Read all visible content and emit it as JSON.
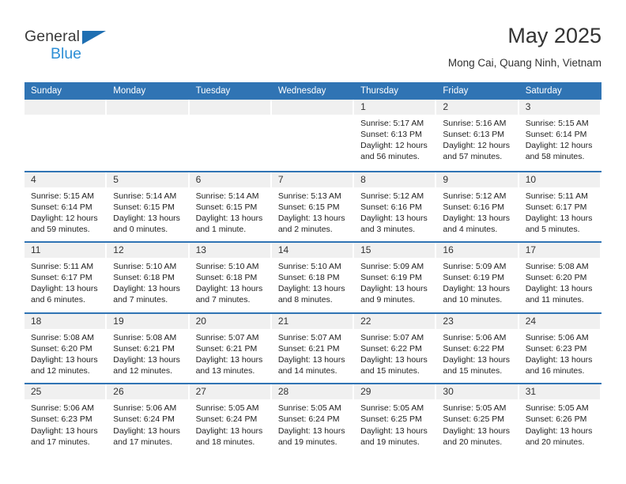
{
  "logo": {
    "top_text": "General",
    "bottom_text": "Blue",
    "triangle_color": "#1f6fb2",
    "blue_color": "#2e8fd6"
  },
  "header": {
    "title": "May 2025",
    "subtitle": "Mong Cai, Quang Ninh, Vietnam"
  },
  "colors": {
    "header_bar": "#3074b4",
    "day_band": "#f0f0f0",
    "week_divider": "#3074b4",
    "text": "#222222"
  },
  "weekdays": [
    "Sunday",
    "Monday",
    "Tuesday",
    "Wednesday",
    "Thursday",
    "Friday",
    "Saturday"
  ],
  "weeks": [
    [
      {
        "day": "",
        "sunrise": "",
        "sunset": "",
        "daylight": ""
      },
      {
        "day": "",
        "sunrise": "",
        "sunset": "",
        "daylight": ""
      },
      {
        "day": "",
        "sunrise": "",
        "sunset": "",
        "daylight": ""
      },
      {
        "day": "",
        "sunrise": "",
        "sunset": "",
        "daylight": ""
      },
      {
        "day": "1",
        "sunrise": "Sunrise: 5:17 AM",
        "sunset": "Sunset: 6:13 PM",
        "daylight": "Daylight: 12 hours and 56 minutes."
      },
      {
        "day": "2",
        "sunrise": "Sunrise: 5:16 AM",
        "sunset": "Sunset: 6:13 PM",
        "daylight": "Daylight: 12 hours and 57 minutes."
      },
      {
        "day": "3",
        "sunrise": "Sunrise: 5:15 AM",
        "sunset": "Sunset: 6:14 PM",
        "daylight": "Daylight: 12 hours and 58 minutes."
      }
    ],
    [
      {
        "day": "4",
        "sunrise": "Sunrise: 5:15 AM",
        "sunset": "Sunset: 6:14 PM",
        "daylight": "Daylight: 12 hours and 59 minutes."
      },
      {
        "day": "5",
        "sunrise": "Sunrise: 5:14 AM",
        "sunset": "Sunset: 6:15 PM",
        "daylight": "Daylight: 13 hours and 0 minutes."
      },
      {
        "day": "6",
        "sunrise": "Sunrise: 5:14 AM",
        "sunset": "Sunset: 6:15 PM",
        "daylight": "Daylight: 13 hours and 1 minute."
      },
      {
        "day": "7",
        "sunrise": "Sunrise: 5:13 AM",
        "sunset": "Sunset: 6:15 PM",
        "daylight": "Daylight: 13 hours and 2 minutes."
      },
      {
        "day": "8",
        "sunrise": "Sunrise: 5:12 AM",
        "sunset": "Sunset: 6:16 PM",
        "daylight": "Daylight: 13 hours and 3 minutes."
      },
      {
        "day": "9",
        "sunrise": "Sunrise: 5:12 AM",
        "sunset": "Sunset: 6:16 PM",
        "daylight": "Daylight: 13 hours and 4 minutes."
      },
      {
        "day": "10",
        "sunrise": "Sunrise: 5:11 AM",
        "sunset": "Sunset: 6:17 PM",
        "daylight": "Daylight: 13 hours and 5 minutes."
      }
    ],
    [
      {
        "day": "11",
        "sunrise": "Sunrise: 5:11 AM",
        "sunset": "Sunset: 6:17 PM",
        "daylight": "Daylight: 13 hours and 6 minutes."
      },
      {
        "day": "12",
        "sunrise": "Sunrise: 5:10 AM",
        "sunset": "Sunset: 6:18 PM",
        "daylight": "Daylight: 13 hours and 7 minutes."
      },
      {
        "day": "13",
        "sunrise": "Sunrise: 5:10 AM",
        "sunset": "Sunset: 6:18 PM",
        "daylight": "Daylight: 13 hours and 7 minutes."
      },
      {
        "day": "14",
        "sunrise": "Sunrise: 5:10 AM",
        "sunset": "Sunset: 6:18 PM",
        "daylight": "Daylight: 13 hours and 8 minutes."
      },
      {
        "day": "15",
        "sunrise": "Sunrise: 5:09 AM",
        "sunset": "Sunset: 6:19 PM",
        "daylight": "Daylight: 13 hours and 9 minutes."
      },
      {
        "day": "16",
        "sunrise": "Sunrise: 5:09 AM",
        "sunset": "Sunset: 6:19 PM",
        "daylight": "Daylight: 13 hours and 10 minutes."
      },
      {
        "day": "17",
        "sunrise": "Sunrise: 5:08 AM",
        "sunset": "Sunset: 6:20 PM",
        "daylight": "Daylight: 13 hours and 11 minutes."
      }
    ],
    [
      {
        "day": "18",
        "sunrise": "Sunrise: 5:08 AM",
        "sunset": "Sunset: 6:20 PM",
        "daylight": "Daylight: 13 hours and 12 minutes."
      },
      {
        "day": "19",
        "sunrise": "Sunrise: 5:08 AM",
        "sunset": "Sunset: 6:21 PM",
        "daylight": "Daylight: 13 hours and 12 minutes."
      },
      {
        "day": "20",
        "sunrise": "Sunrise: 5:07 AM",
        "sunset": "Sunset: 6:21 PM",
        "daylight": "Daylight: 13 hours and 13 minutes."
      },
      {
        "day": "21",
        "sunrise": "Sunrise: 5:07 AM",
        "sunset": "Sunset: 6:21 PM",
        "daylight": "Daylight: 13 hours and 14 minutes."
      },
      {
        "day": "22",
        "sunrise": "Sunrise: 5:07 AM",
        "sunset": "Sunset: 6:22 PM",
        "daylight": "Daylight: 13 hours and 15 minutes."
      },
      {
        "day": "23",
        "sunrise": "Sunrise: 5:06 AM",
        "sunset": "Sunset: 6:22 PM",
        "daylight": "Daylight: 13 hours and 15 minutes."
      },
      {
        "day": "24",
        "sunrise": "Sunrise: 5:06 AM",
        "sunset": "Sunset: 6:23 PM",
        "daylight": "Daylight: 13 hours and 16 minutes."
      }
    ],
    [
      {
        "day": "25",
        "sunrise": "Sunrise: 5:06 AM",
        "sunset": "Sunset: 6:23 PM",
        "daylight": "Daylight: 13 hours and 17 minutes."
      },
      {
        "day": "26",
        "sunrise": "Sunrise: 5:06 AM",
        "sunset": "Sunset: 6:24 PM",
        "daylight": "Daylight: 13 hours and 17 minutes."
      },
      {
        "day": "27",
        "sunrise": "Sunrise: 5:05 AM",
        "sunset": "Sunset: 6:24 PM",
        "daylight": "Daylight: 13 hours and 18 minutes."
      },
      {
        "day": "28",
        "sunrise": "Sunrise: 5:05 AM",
        "sunset": "Sunset: 6:24 PM",
        "daylight": "Daylight: 13 hours and 19 minutes."
      },
      {
        "day": "29",
        "sunrise": "Sunrise: 5:05 AM",
        "sunset": "Sunset: 6:25 PM",
        "daylight": "Daylight: 13 hours and 19 minutes."
      },
      {
        "day": "30",
        "sunrise": "Sunrise: 5:05 AM",
        "sunset": "Sunset: 6:25 PM",
        "daylight": "Daylight: 13 hours and 20 minutes."
      },
      {
        "day": "31",
        "sunrise": "Sunrise: 5:05 AM",
        "sunset": "Sunset: 6:26 PM",
        "daylight": "Daylight: 13 hours and 20 minutes."
      }
    ]
  ]
}
